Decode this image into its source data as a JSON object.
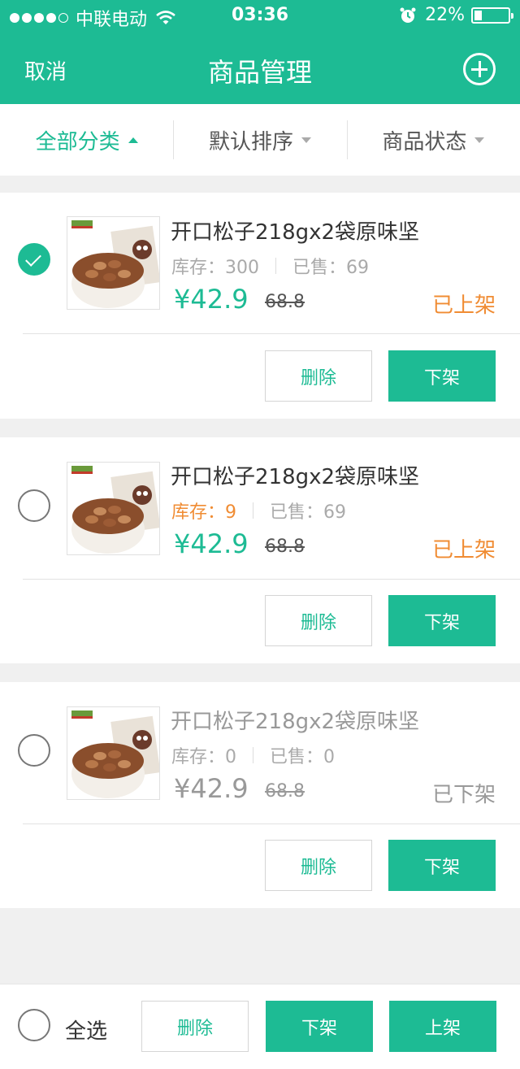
{
  "status_bar": {
    "carrier": "中联电动",
    "time": "03:36",
    "battery_text": "22%",
    "battery_level": 0.22,
    "signal_dots": [
      true,
      true,
      true,
      true,
      false
    ]
  },
  "nav": {
    "cancel": "取消",
    "title": "商品管理",
    "add_icon": "plus-circle-icon"
  },
  "filters": [
    {
      "label": "全部分类",
      "active": true
    },
    {
      "label": "默认排序",
      "active": false
    },
    {
      "label": "商品状态",
      "active": false
    }
  ],
  "products": [
    {
      "checked": true,
      "name": "开口松子218gx2袋原味坚",
      "stock_label": "库存：300",
      "sold_label": "已售：69",
      "price": "¥42.9",
      "original_price": "68.8",
      "status": "已上架",
      "delete_label": "删除",
      "action_label": "下架"
    },
    {
      "checked": false,
      "name": "开口松子218gx2袋原味坚",
      "stock_label": "库存：9",
      "sold_label": "已售：69",
      "price": "¥42.9",
      "original_price": "68.8",
      "status": "已上架",
      "delete_label": "删除",
      "action_label": "下架"
    },
    {
      "checked": false,
      "name": "开口松子218gx2袋原味坚",
      "stock_label": "库存：0",
      "sold_label": "已售：0",
      "price": "¥42.9",
      "original_price": "68.8",
      "status": "已下架",
      "delete_label": "删除",
      "action_label": "下架"
    }
  ],
  "bottom_bar": {
    "select_all": "全选",
    "delete": "删除",
    "off_shelf": "下架",
    "on_shelf": "上架"
  },
  "colors": {
    "primary": "#1dbb94",
    "warning": "#f08c33",
    "muted": "#999999"
  }
}
